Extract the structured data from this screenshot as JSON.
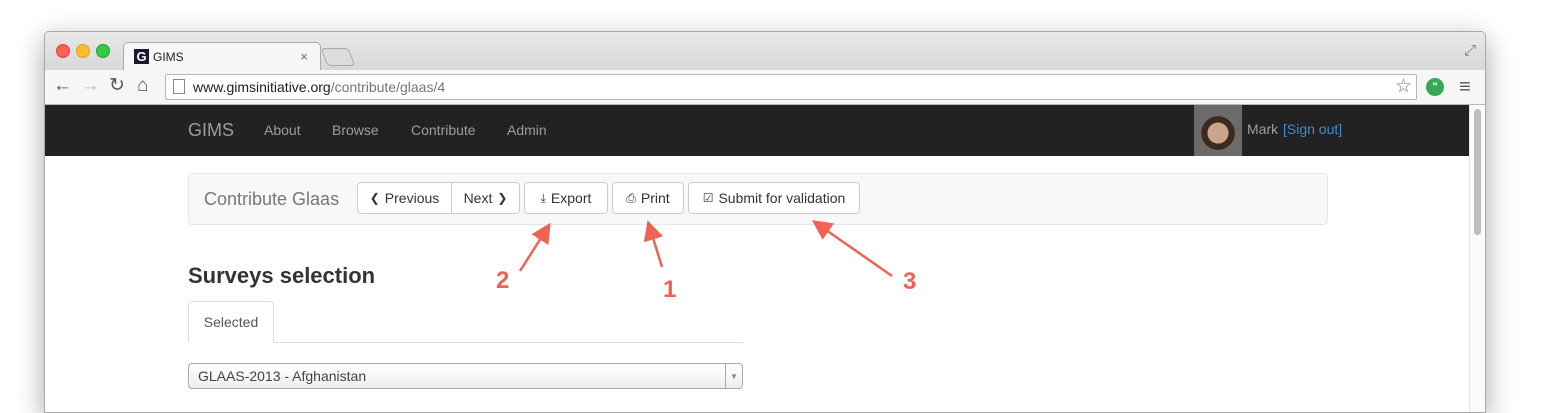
{
  "browser": {
    "tab_title": "GIMS",
    "favicon_letter": "G",
    "url_domain": "www.gimsinitiative.org",
    "url_path": "/contribute/glaas/4"
  },
  "navbar": {
    "brand": "GIMS",
    "links": [
      "About",
      "Browse",
      "Contribute",
      "Admin"
    ],
    "user_name": "Mark",
    "sign_out": "[Sign out]"
  },
  "contribute_bar": {
    "title": "Contribute Glaas",
    "previous_label": "Previous",
    "next_label": "Next",
    "export_label": "Export",
    "print_label": "Print",
    "submit_label": "Submit for validation"
  },
  "surveys": {
    "heading": "Surveys selection",
    "tab_label": "Selected",
    "selected_value": "GLAAS-2013 - Afghanistan"
  },
  "annotations": {
    "labels": [
      "2",
      "1",
      "3"
    ],
    "color": "#ee6352"
  },
  "colors": {
    "navbar_bg": "#222222",
    "link_accent": "#428bca"
  }
}
